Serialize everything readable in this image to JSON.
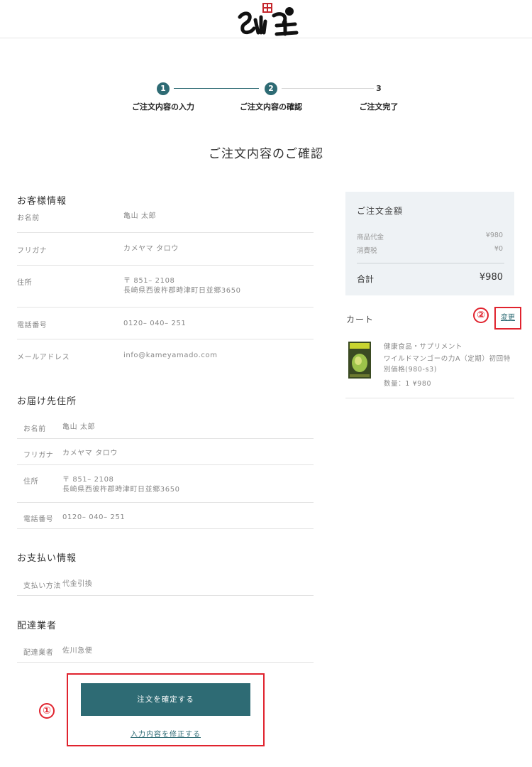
{
  "brand": {
    "logo_icon": "kameyamado-logo-icon"
  },
  "steps": [
    {
      "number": "1",
      "label": "ご注文内容の入力",
      "state": "done"
    },
    {
      "number": "2",
      "label": "ご注文内容の確認",
      "state": "current"
    },
    {
      "number": "3",
      "label": "ご注文完了",
      "state": "todo"
    }
  ],
  "page_title": "ご注文内容のご確認",
  "customer": {
    "title": "お客様情報",
    "rows": [
      {
        "label": "お名前",
        "value": "亀山 太郎"
      },
      {
        "label": "フリガナ",
        "value": "カメヤマ タロウ"
      },
      {
        "label": "住所",
        "value": "〒 851– 2108",
        "value2": "長崎県西彼杵郡時津町日並郷3650"
      },
      {
        "label": "電話番号",
        "value": "0120– 040– 251"
      },
      {
        "label": "メールアドレス",
        "value": "info@kameyamado.com"
      }
    ]
  },
  "delivery": {
    "title": "お届け先住所",
    "rows": [
      {
        "label": "お名前",
        "value": "亀山 太郎"
      },
      {
        "label": "フリガナ",
        "value": "カメヤマ タロウ"
      },
      {
        "label": "住所",
        "value": "〒 851– 2108",
        "value2": "長崎県西彼杵郡時津町日並郷3650"
      },
      {
        "label": "電話番号",
        "value": "0120– 040– 251"
      }
    ]
  },
  "payment": {
    "title": "お支払い情報",
    "label": "支払い方法",
    "value": "代金引換"
  },
  "carrier": {
    "title": "配達業者",
    "label": "配達業者",
    "value": "佐川急便"
  },
  "summary": {
    "title": "ご注文金額",
    "subtotal_label": "商品代金",
    "subtotal_value": "¥980",
    "tax_label": "消費税",
    "tax_value": "¥0",
    "total_label": "合計",
    "total_value": "¥980"
  },
  "cart": {
    "title": "カート",
    "change_label": "変更",
    "item": {
      "category": "健康食品・サプリメント",
      "name_line1": "ワイルドマンゴーの力A（定期）初回特",
      "name_line2": "別価格(980-s3)",
      "qty_price": "数量：1  ¥980"
    }
  },
  "actions": {
    "confirm_label": "注文を確定する",
    "edit_label": "入力内容を修正する"
  },
  "annotations": {
    "mark1": "①",
    "mark2": "②"
  },
  "colors": {
    "accent": "#2e6b74",
    "highlight": "#e0232e",
    "summary_bg": "#eef2f5"
  }
}
